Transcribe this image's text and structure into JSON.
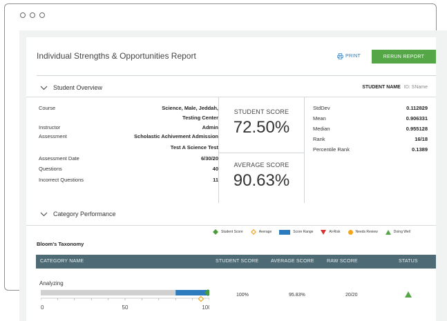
{
  "window": {
    "controls": [
      "dot",
      "dot",
      "dot"
    ]
  },
  "header": {
    "title": "Individual Strengths & Opportunities Report",
    "print_label": "PRINT",
    "rerun_label": "RERUN REPORT",
    "print_icon": "printer-icon"
  },
  "overview": {
    "section_title": "Student Overview",
    "student_name_label": "STUDENT NAME",
    "student_name_value": "ID: SName",
    "details": {
      "course_label": "Course",
      "course_value_line1": "Science, Male, Jeddah,",
      "course_value_line2": "Testing Center",
      "instructor_label": "Instructor",
      "instructor_value": "Admin",
      "assessment_label": "Assessment",
      "assessment_value_line1": "Scholastic Achivement Admission",
      "assessment_value_line2": "Test A Science Test",
      "date_label": "Assessment Date",
      "date_value": "6/30/20",
      "questions_label": "Questions",
      "questions_value": "40",
      "incorrect_label": "Incorrect Questions",
      "incorrect_value": "11"
    },
    "student_score_label": "STUDENT SCORE",
    "student_score_value": "72.50%",
    "average_score_label": "AVERAGE SCORE",
    "average_score_value": "90.63%",
    "stats": [
      {
        "label": "StdDev",
        "value": "0.112829"
      },
      {
        "label": "Mean",
        "value": "0.906331"
      },
      {
        "label": "Median",
        "value": "0.955128"
      },
      {
        "label": "Rank",
        "value": "16/18"
      },
      {
        "label": "Percentile Rank",
        "value": "0.1389"
      }
    ]
  },
  "category": {
    "section_title": "Category Performance",
    "legend": {
      "student_score": "Student Score",
      "average": "Average",
      "score_range": "Score Range",
      "at_risk": "At-Risk",
      "needs_review": "Needs Review",
      "doing_well": "Doing Well"
    },
    "taxonomy_label": "Bloom's Taxonomy",
    "columns": {
      "name": "CATEGORY NAME",
      "student": "STUDENT SCORE",
      "average": "AVERAGE SCORE",
      "raw": "RAW SCORE",
      "status": "STATUS"
    },
    "rows": [
      {
        "name": "Analyzing",
        "student_score": "100%",
        "average_score": "95.83%",
        "raw_score": "20/20",
        "status_icon": "doing-well-icon",
        "student_value": 100,
        "average_value": 95.83,
        "range_min": 80,
        "range_max": 100
      }
    ],
    "axis_ticks": [
      "0",
      "50",
      "100"
    ]
  },
  "colors": {
    "accent_green": "#55a647",
    "header_bar": "#4e6b75",
    "range_blue": "#2b7bbd",
    "student_marker": "#4a9a3c",
    "average_marker": "#f3a51b",
    "at_risk": "#d9312b",
    "needs_review": "#f3a51b",
    "doing_well": "#55a647",
    "link_blue": "#2f7bbd"
  }
}
